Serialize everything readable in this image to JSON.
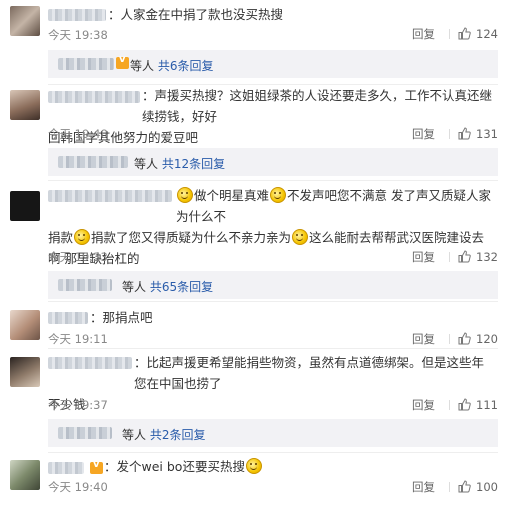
{
  "comments": [
    {
      "text": "：人家金在中捐了款也没买热搜",
      "time": "今天 19:38",
      "reply": "回复",
      "likes": "124",
      "sub": {
        "names_suffix": "等人",
        "link": "共6条回复"
      }
    },
    {
      "text_line1": "：声援买热搜？这姐姐绿茶的人设还要走多久，工作不认真还继续捞钱，好好",
      "text_line2": "回韩国学其他努力的爱豆吧",
      "time": "今天 19:48",
      "reply": "回复",
      "likes": "131",
      "sub": {
        "names_suffix": "等人",
        "link": "共12条回复"
      }
    },
    {
      "text_a": "做个明星真难",
      "text_b": "不发声吧您不满意 发了声又质疑人家为什么不",
      "text_c": "捐款",
      "text_d": "捐款了您又得质疑为什么不亲力亲为",
      "text_e": "这么能耐去帮帮武汉医院建设去啊 那里缺抬杠的",
      "time": "今天 19:33",
      "reply": "回复",
      "likes": "132",
      "sub": {
        "names_suffix": "等人",
        "link": "共65条回复"
      }
    },
    {
      "text": "：那捐点吧",
      "time": "今天 19:11",
      "reply": "回复",
      "likes": "120"
    },
    {
      "text_line1": "：比起声援更希望能捐些物资，虽然有点道德绑架。但是这些年您在中国也捞了",
      "text_line2": "不少钱",
      "time": "今天 19:37",
      "reply": "回复",
      "likes": "111",
      "sub": {
        "names_suffix": "等人",
        "link": "共2条回复"
      }
    },
    {
      "text_a": "：发个wei bo还要买热搜",
      "time": "今天 19:40",
      "reply": "回复",
      "likes": "100"
    }
  ]
}
